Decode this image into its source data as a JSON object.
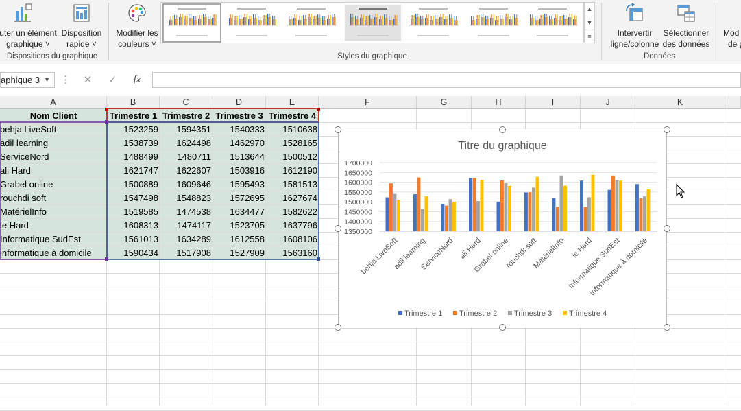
{
  "ribbon": {
    "add_element": "uter un élément\ngraphique ˅",
    "add_element_l1": "uter un élément",
    "add_element_l2": "graphique ˅",
    "quick_layout_l1": "Disposition",
    "quick_layout_l2": "rapide ˅",
    "group_layouts": "Dispositions du graphique",
    "change_colors_l1": "Modifier les",
    "change_colors_l2": "couleurs ˅",
    "group_styles": "Styles du graphique",
    "switch_l1": "Intervertir",
    "switch_l2": "ligne/colonne",
    "select_data_l1": "Sélectionner",
    "select_data_l2": "des données",
    "group_data": "Données",
    "mod_l1": "Mod",
    "mod_l2": "de g"
  },
  "formula_bar": {
    "name_box": "aphique 3",
    "cancel": "✕",
    "enter": "✓",
    "fx": "fx",
    "value": ""
  },
  "columns": [
    "A",
    "B",
    "C",
    "D",
    "E",
    "F",
    "G",
    "H",
    "I",
    "J",
    "K"
  ],
  "table": {
    "headers": [
      "Nom Client",
      "Trimestre 1",
      "Trimestre 2",
      "Trimestre 3",
      "Trimestre 4"
    ],
    "rows": [
      [
        "behja LiveSoft",
        "1523259",
        "1594351",
        "1540333",
        "1510638"
      ],
      [
        "adil learning",
        "1538739",
        "1624498",
        "1462970",
        "1528165"
      ],
      [
        "ServiceNord",
        "1488499",
        "1480711",
        "1513644",
        "1500512"
      ],
      [
        "ali Hard",
        "1621747",
        "1622607",
        "1503916",
        "1612190"
      ],
      [
        "Grabel online",
        "1500889",
        "1609646",
        "1595493",
        "1581513"
      ],
      [
        "rouchdi soft",
        "1547498",
        "1548823",
        "1572695",
        "1627674"
      ],
      [
        "MatérielInfo",
        "1519585",
        "1474538",
        "1634477",
        "1582622"
      ],
      [
        "le Hard",
        "1608313",
        "1474117",
        "1523705",
        "1637796"
      ],
      [
        "Informatique SudEst",
        "1561013",
        "1634289",
        "1612558",
        "1608106"
      ],
      [
        "informatique à domicile",
        "1590434",
        "1517908",
        "1527909",
        "1563160"
      ]
    ]
  },
  "chart_data": {
    "type": "bar",
    "title": "Titre du graphique",
    "categories": [
      "behja LiveSoft",
      "adil learning",
      "ServiceNord",
      "ali Hard",
      "Grabel online",
      "rouchdi soft",
      "MatérielInfo",
      "le Hard",
      "Informatique SudEst",
      "informatique à domicile"
    ],
    "series": [
      {
        "name": "Trimestre 1",
        "color": "#4472c4",
        "values": [
          1523259,
          1538739,
          1488499,
          1621747,
          1500889,
          1547498,
          1519585,
          1608313,
          1561013,
          1590434
        ]
      },
      {
        "name": "Trimestre 2",
        "color": "#ed7d31",
        "values": [
          1594351,
          1624498,
          1480711,
          1622607,
          1609646,
          1548823,
          1474538,
          1474117,
          1634289,
          1517908
        ]
      },
      {
        "name": "Trimestre 3",
        "color": "#a5a5a5",
        "values": [
          1540333,
          1462970,
          1513644,
          1503916,
          1595493,
          1572695,
          1634477,
          1523705,
          1612558,
          1527909
        ]
      },
      {
        "name": "Trimestre 4",
        "color": "#ffc000",
        "values": [
          1510638,
          1528165,
          1500512,
          1612190,
          1581513,
          1627674,
          1582622,
          1637796,
          1608106,
          1563160
        ]
      }
    ],
    "yticks": [
      "1700000",
      "1650000",
      "1600000",
      "1550000",
      "1500000",
      "1450000",
      "1400000",
      "1350000"
    ],
    "ylim": [
      1350000,
      1700000
    ],
    "legend": "bottom",
    "grid": true
  }
}
